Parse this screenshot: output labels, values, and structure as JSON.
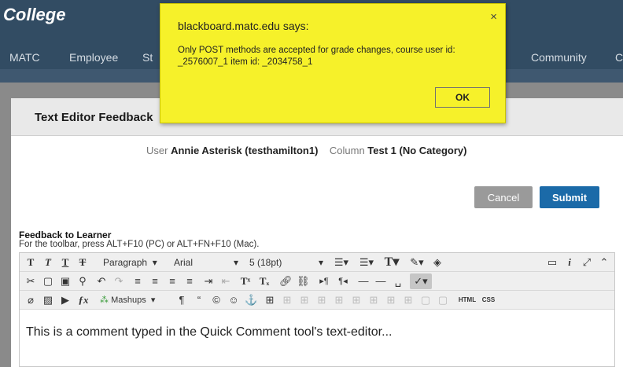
{
  "site": {
    "brand": "College",
    "nav": [
      "MATC",
      "Employee",
      "St",
      "Community",
      "C"
    ]
  },
  "page": {
    "title": "Text Editor Feedback",
    "user_label": "User",
    "user_name": "Annie Asterisk (testhamilton1)",
    "column_label": "Column",
    "column_name": "Test 1 (No Category)",
    "cancel": "Cancel",
    "submit": "Submit",
    "feedback_label": "Feedback to Learner",
    "feedback_hint": "For the toolbar, press ALT+F10 (PC) or ALT+FN+F10 (Mac)."
  },
  "editor": {
    "paragraph": "Paragraph",
    "font": "Arial",
    "size": "5 (18pt)",
    "mashups": "Mashups",
    "html": "HTML",
    "css": "CSS",
    "content": "This is a comment typed in the Quick Comment tool's text-editor..."
  },
  "dialog": {
    "title": "blackboard.matc.edu says:",
    "message": "Only POST methods are accepted for grade changes, course user id: _2576007_1 item id: _2034758_1",
    "ok": "OK",
    "close": "×"
  }
}
